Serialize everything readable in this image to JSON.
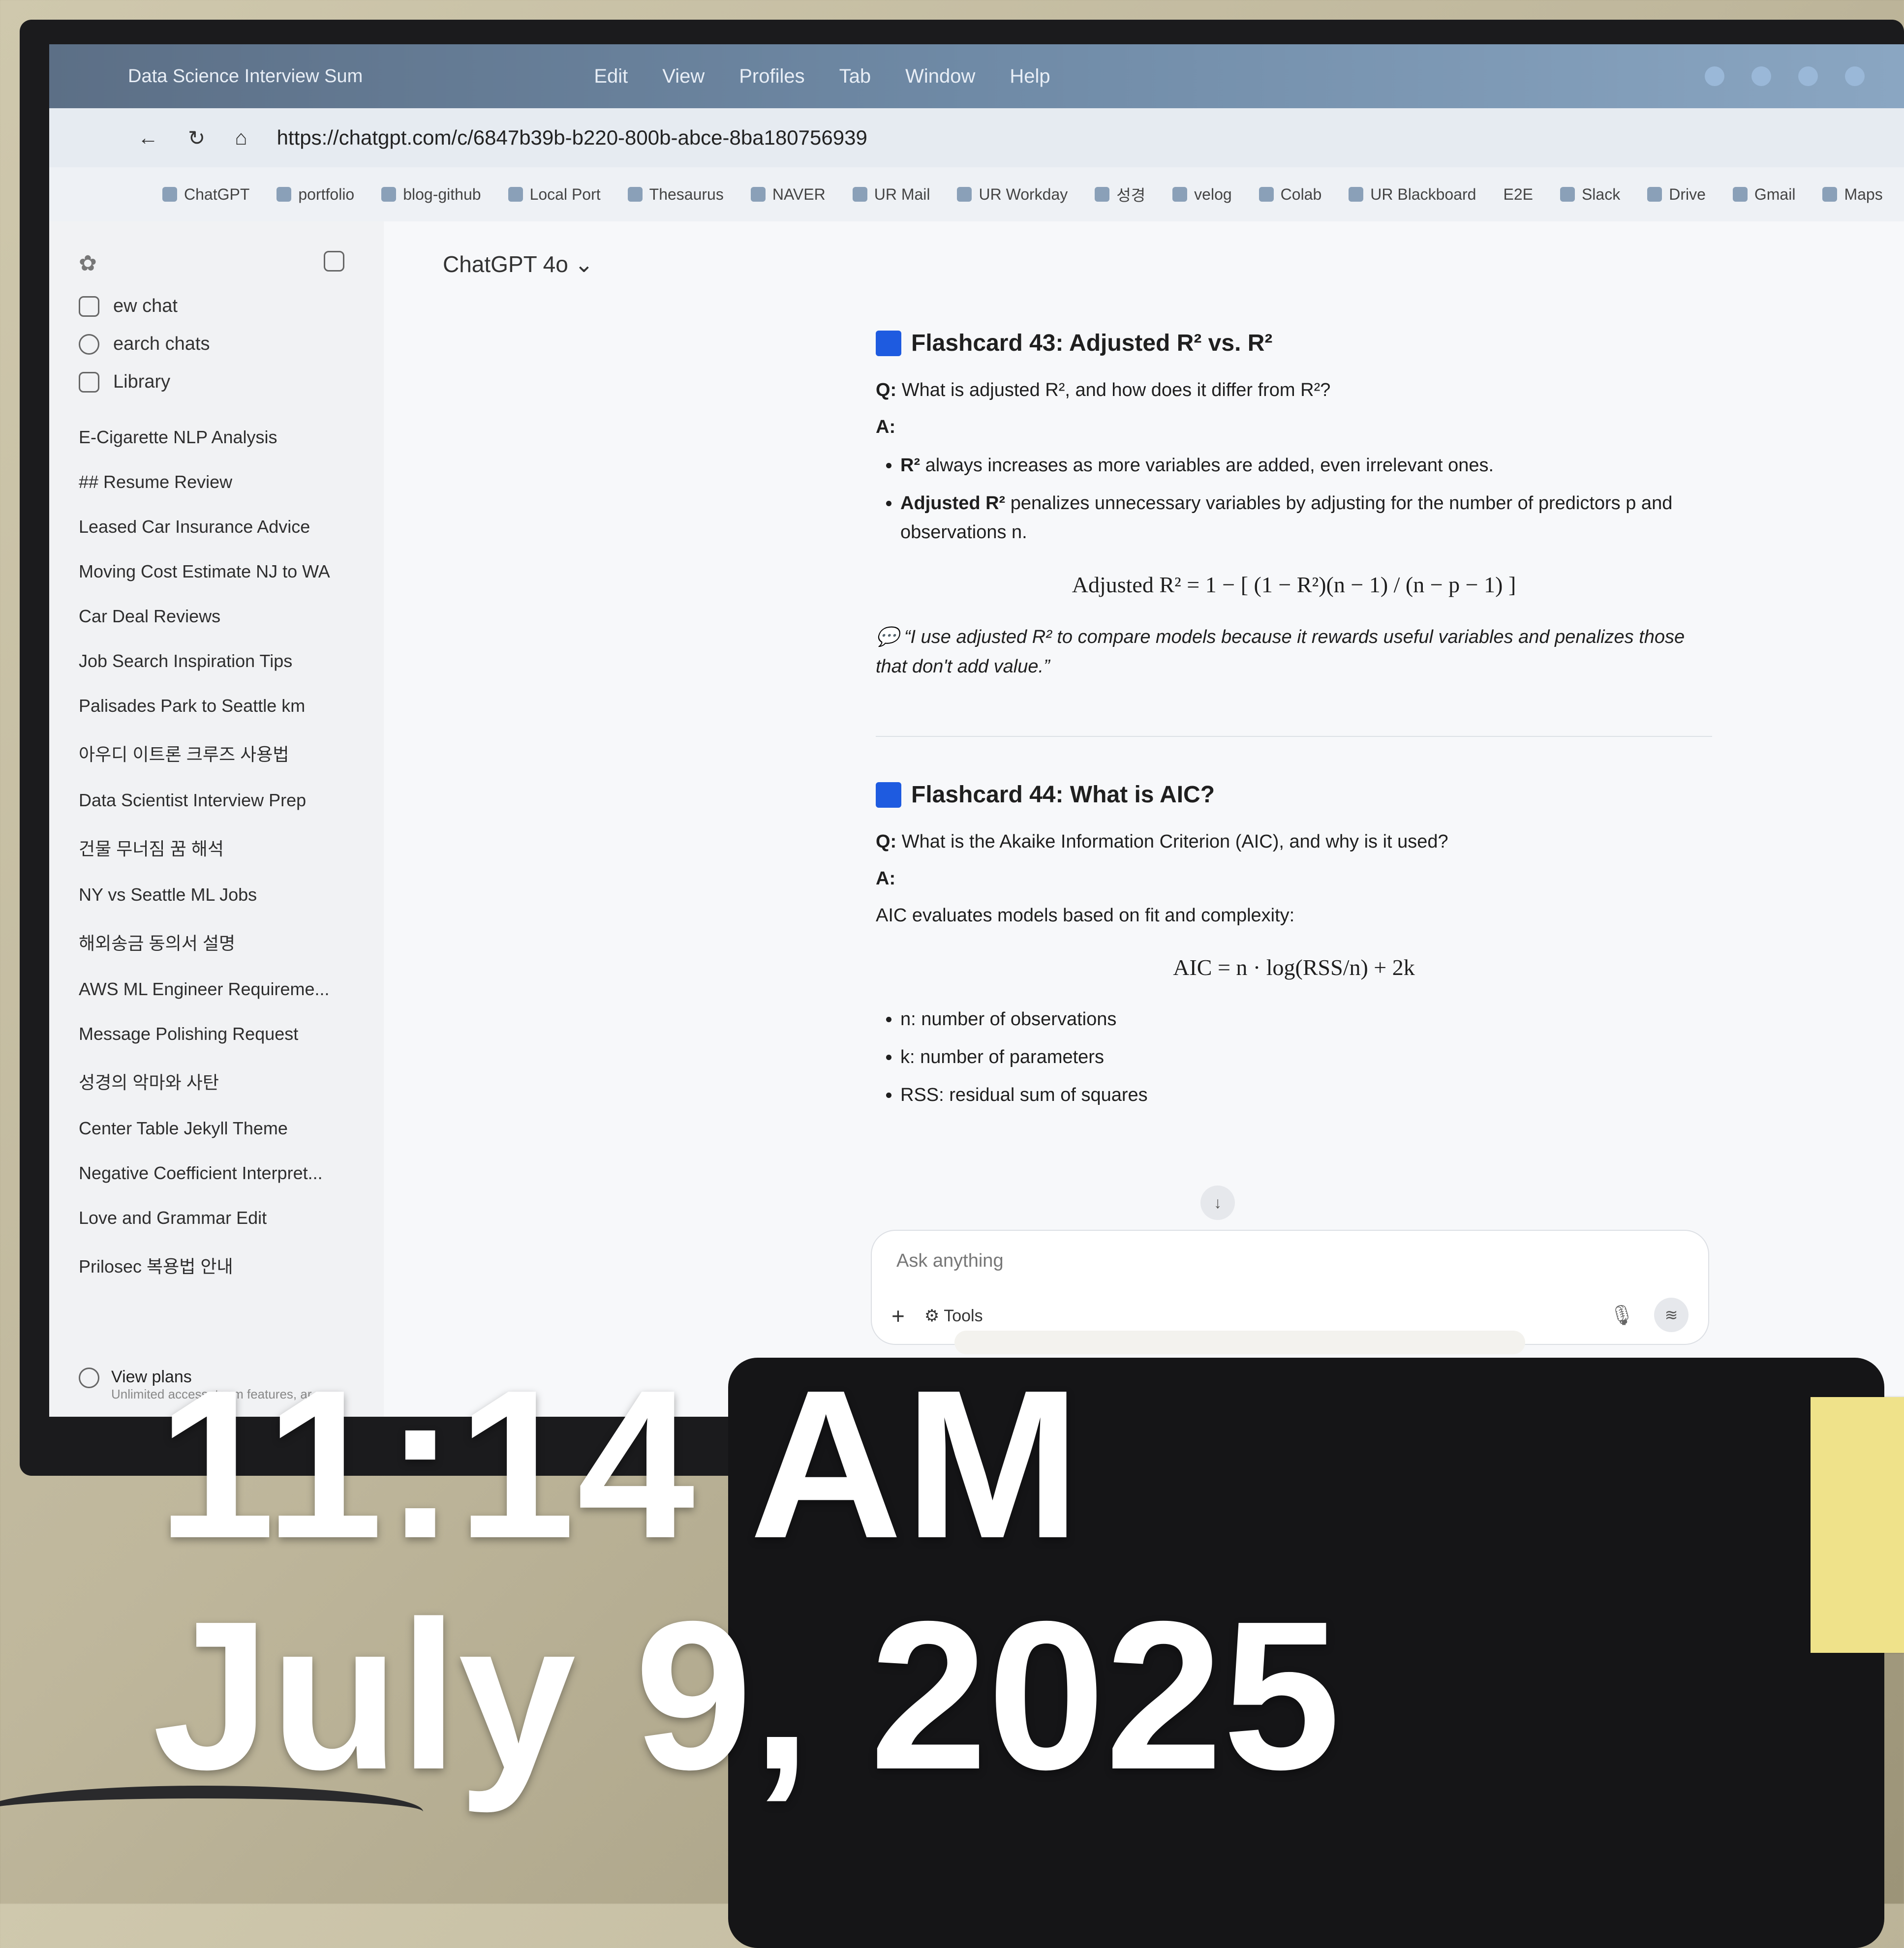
{
  "browser": {
    "menu_items": [
      "Edit",
      "View",
      "Profiles",
      "Tab",
      "Window",
      "Help"
    ],
    "tab_title": "Data Science Interview Sum",
    "url": "https://chatgpt.com/c/6847b39b-b220-800b-abce-8ba180756939",
    "bookmarks": [
      "ChatGPT",
      "portfolio",
      "blog-github",
      "Local Port",
      "Thesaurus",
      "NAVER",
      "UR Mail",
      "UR Workday",
      "성경",
      "velog",
      "Colab",
      "UR Blackboard",
      "E2E",
      "Slack",
      "Drive",
      "Gmail",
      "Maps"
    ]
  },
  "sidebar": {
    "actions": [
      {
        "label": "ew chat",
        "icon": "pencil-icon"
      },
      {
        "label": "earch chats",
        "icon": "search-icon"
      },
      {
        "label": "Library",
        "icon": "library-icon"
      }
    ],
    "chats": [
      "E-Cigarette NLP Analysis",
      "## Resume Review",
      "Leased Car Insurance Advice",
      "Moving Cost Estimate NJ to WA",
      "Car Deal Reviews",
      "Job Search Inspiration Tips",
      "Palisades Park to Seattle km",
      "아우디 이트론 크루즈 사용법",
      "Data Scientist Interview Prep",
      "건물 무너짐 꿈 해석",
      "NY vs Seattle ML Jobs",
      "해외송금 동의서 설명",
      "AWS ML Engineer Requireme...",
      "Message Polishing Request",
      "성경의 악마와 사탄",
      "Center Table Jekyll Theme",
      "Negative Coefficient Interpret...",
      "Love and Grammar Edit",
      "Prilosec 복용법 안내"
    ],
    "view_plans": {
      "title": "View plans",
      "subtitle": "Unlimited access, team features, ar"
    }
  },
  "main": {
    "model": "ChatGPT 4o",
    "card43": {
      "title": "Flashcard 43: Adjusted R² vs. R²",
      "question_prefix": "Q:",
      "question": "What is adjusted R², and how does it differ from R²?",
      "answer_prefix": "A:",
      "bullet1_bold": "R²",
      "bullet1": "always increases as more variables are added, even irrelevant ones.",
      "bullet2_bold": "Adjusted R²",
      "bullet2": "penalizes unnecessary variables by adjusting for the number of predictors p and observations n.",
      "formula": "Adjusted R² = 1 − [ (1 − R²)(n − 1) / (n − p − 1) ]",
      "quote": "“I use adjusted R² to compare models because it rewards useful variables and penalizes those that don't add value.”"
    },
    "card44": {
      "title": "Flashcard 44: What is AIC?",
      "question_prefix": "Q:",
      "question": "What is the Akaike Information Criterion (AIC), and why is it used?",
      "answer_prefix": "A:",
      "intro": "AIC evaluates models based on fit and complexity:",
      "formula": "AIC = n · log(RSS/n) + 2k",
      "bullets": [
        "n: number of observations",
        "k: number of parameters",
        "RSS: residual sum of squares"
      ]
    },
    "composer": {
      "placeholder": "Ask anything",
      "tools_label": "Tools"
    }
  },
  "overlay": {
    "time": "11:14 AM",
    "date": "July 9, 2025"
  },
  "colors": {
    "flashcard_square": "#1e5be0",
    "overlay_text": "#ffffff"
  }
}
